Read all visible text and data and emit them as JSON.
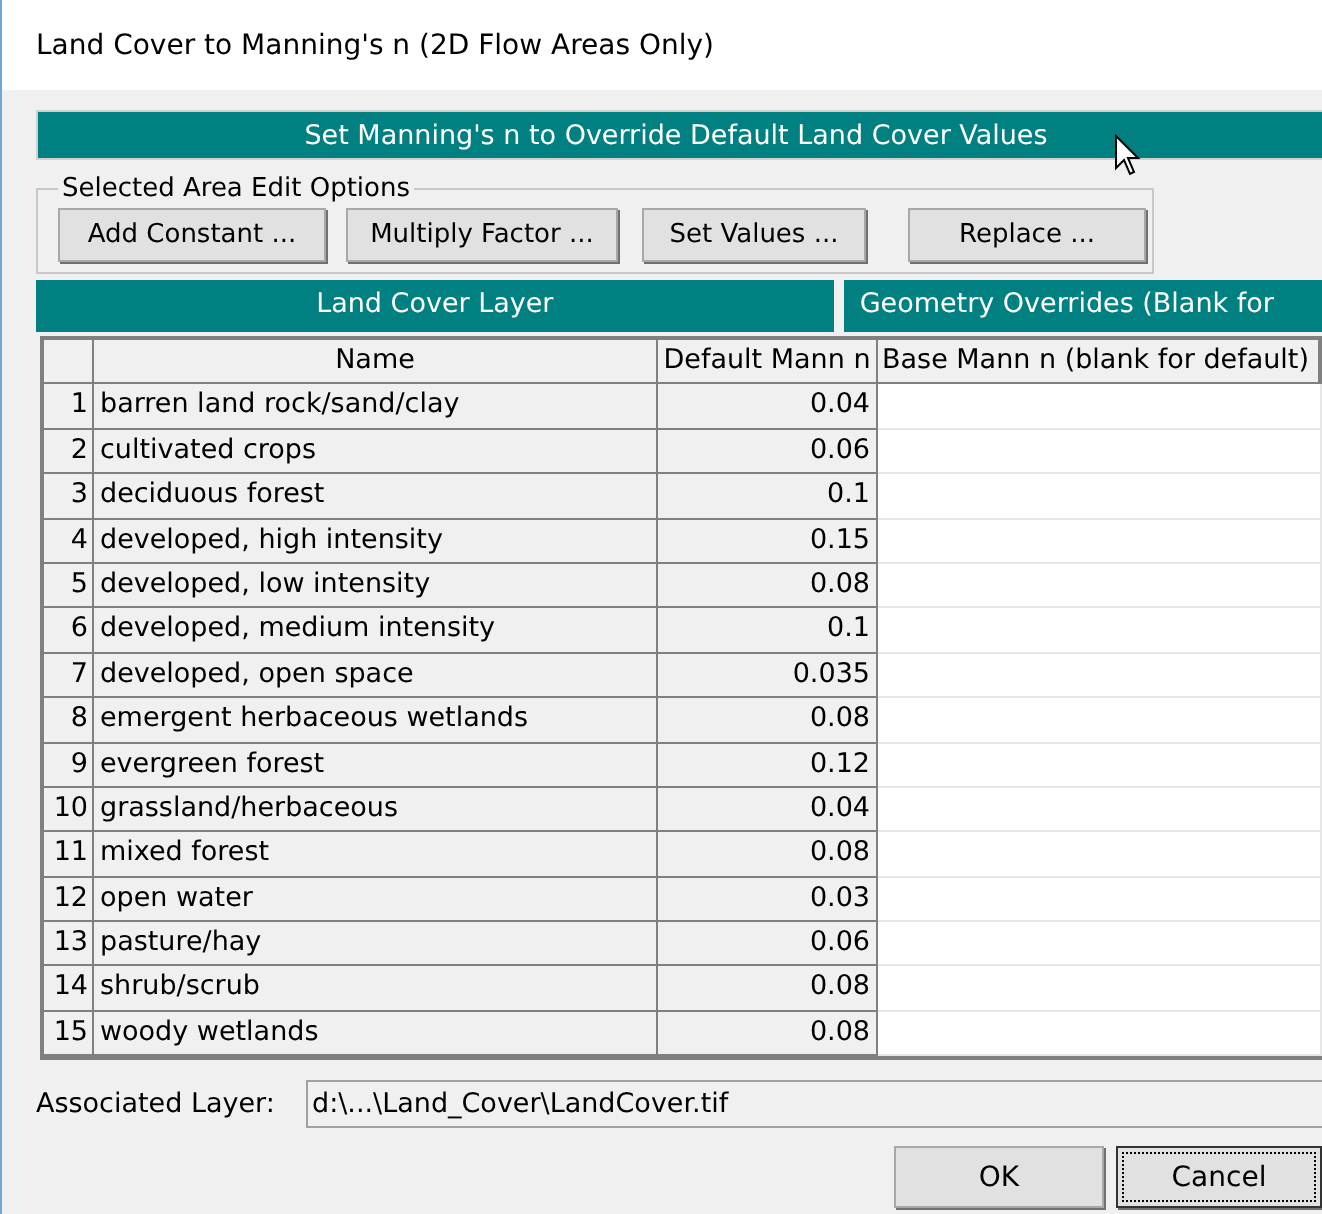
{
  "window": {
    "title": "Land Cover to Manning's n (2D Flow Areas Only)"
  },
  "banner": "Set Manning's n to Override Default Land Cover Values",
  "edit_options": {
    "label": "Selected Area Edit Options",
    "buttons": [
      "Add Constant ...",
      "Multiply Factor ...",
      "Set Values ...",
      "Replace ..."
    ]
  },
  "group_headers": [
    "Land Cover Layer",
    "Geometry Overrides (Blank for"
  ],
  "table": {
    "columns": [
      "Name",
      "Default Mann n",
      "Base Mann n (blank for default)"
    ],
    "rows": [
      {
        "number": "1",
        "name": "barren land rock/sand/clay",
        "default": "0.04"
      },
      {
        "number": "2",
        "name": "cultivated crops",
        "default": "0.06"
      },
      {
        "number": "3",
        "name": "deciduous forest",
        "default": "0.1"
      },
      {
        "number": "4",
        "name": "developed, high intensity",
        "default": "0.15"
      },
      {
        "number": "5",
        "name": "developed, low intensity",
        "default": "0.08"
      },
      {
        "number": "6",
        "name": "developed, medium intensity",
        "default": "0.1"
      },
      {
        "number": "7",
        "name": "developed, open space",
        "default": "0.035"
      },
      {
        "number": "8",
        "name": "emergent herbaceous wetlands",
        "default": "0.08"
      },
      {
        "number": "9",
        "name": "evergreen forest",
        "default": "0.12"
      },
      {
        "number": "10",
        "name": "grassland/herbaceous",
        "default": "0.04"
      },
      {
        "number": "11",
        "name": "mixed forest",
        "default": "0.08"
      },
      {
        "number": "12",
        "name": "open water",
        "default": "0.03"
      },
      {
        "number": "13",
        "name": "pasture/hay",
        "default": "0.06"
      },
      {
        "number": "14",
        "name": "shrub/scrub",
        "default": "0.08"
      },
      {
        "number": "15",
        "name": "woody wetlands",
        "default": "0.08"
      }
    ]
  },
  "associated_layer": {
    "label": "Associated Layer:",
    "value": "d:\\...\\Land_Cover\\LandCover.tif"
  },
  "buttons": [
    "OK",
    "Cancel"
  ]
}
